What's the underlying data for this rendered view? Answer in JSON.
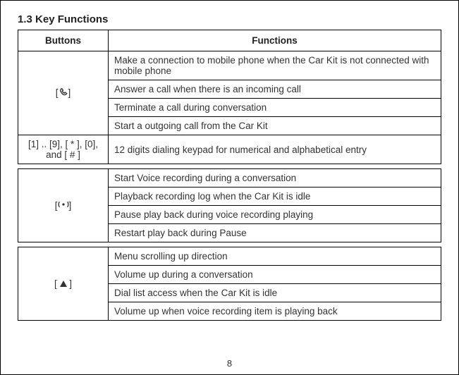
{
  "section_title": "1.3  Key Functions",
  "headers": {
    "buttons": "Buttons",
    "functions": "Functions"
  },
  "groups": [
    {
      "button_prefix": "[",
      "button_suffix": "]",
      "icon": "call",
      "functions": [
        "Make a connection to mobile phone when the Car Kit is not connected with mobile phone",
        "Answer a call when there is an incoming call",
        "Terminate a call during conversation",
        "Start a outgoing call from the Car Kit"
      ]
    },
    {
      "button_text": "[1] .. [9], [ * ], [0], and [ # ]",
      "functions": [
        "12 digits dialing keypad for numerical and alphabetical entry"
      ]
    },
    {
      "button_prefix": "[",
      "button_suffix": "]",
      "icon": "record",
      "functions": [
        "Start Voice recording during a conversation",
        "Playback recording log when the Car Kit is idle",
        "Pause play back during voice recording playing",
        "Restart play back during Pause"
      ]
    },
    {
      "button_prefix": "[ ",
      "button_suffix": " ]",
      "icon": "up",
      "functions": [
        "Menu scrolling up direction",
        "Volume up during a conversation",
        "Dial list access when the Car Kit is idle",
        "Volume up when voice recording item is playing back"
      ]
    }
  ],
  "page_number": "8"
}
